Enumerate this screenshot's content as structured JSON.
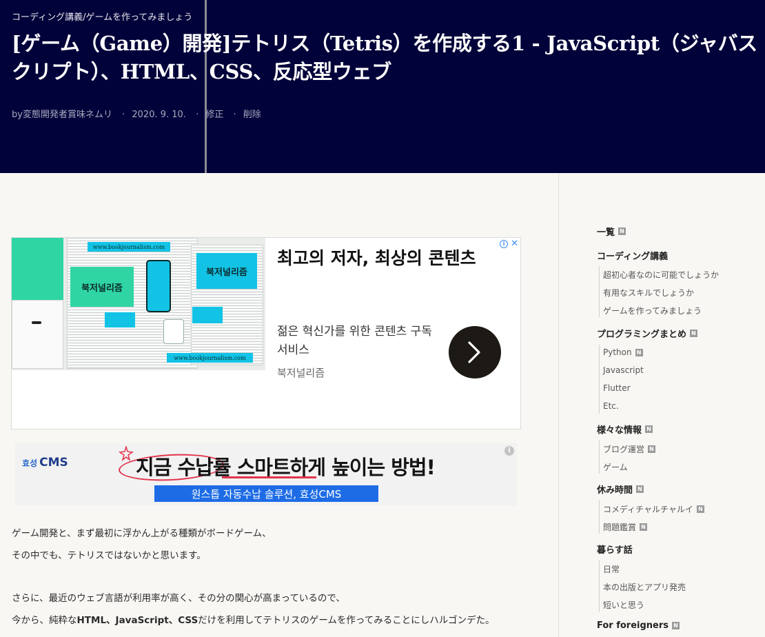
{
  "header": {
    "category": "コーディング講義/ゲームを作ってみましょう",
    "title": "[ゲーム（Game）開発]テトリス（Tetris）を作成する1 - JavaScript（ジャバスクリプト）、HTML、CSS、反応型ウェブ",
    "author": "by変態開発者賞味ネムリ",
    "date": "2020. 9. 10.",
    "edit_label": "修正",
    "delete_label": "削除"
  },
  "ad1": {
    "headline": "최고의 저자, 최상의 콘텐츠",
    "description": "젊은 혁신가를 위한 콘텐츠 구독 서비스",
    "brand": "북저널리즘",
    "image_label": "북저널리즘",
    "image_url": "www.bookjournalism.com"
  },
  "ad2": {
    "logo_prefix": "효성",
    "logo_name": "CMS",
    "headline": "지금 수납률 스마트하게 높이는 방법!",
    "bar_text": "원스톱 자동수납 솔루션, 효성CMS",
    "info_glyph": "i"
  },
  "body": {
    "lines": [
      "ゲーム開発と、まず最初に浮かん上がる種類がボードゲーム、",
      "その中でも、テトリスではないかと思います。",
      "さらに、最近のウェブ言語が利用率が高く、その分の関心が高まっているので、"
    ],
    "line4_prefix": "今から、純粋な",
    "line4_bold": "HTML、JavaScript、CSS",
    "line4_suffix": "だけを利用してテトリスのゲームを作ってみることにしハルゴンデた。"
  },
  "sidebar": {
    "badge": "N",
    "all_label": "一覧",
    "groups": [
      {
        "title": "コーディング講義",
        "items": [
          "超初心者なのに可能でしょうか",
          "有用なスキルでしょうか",
          "ゲームを作ってみましょう"
        ]
      },
      {
        "title": "プログラミングまとめ",
        "items": [
          "Python",
          "Javascript",
          "Flutter",
          "Etc."
        ]
      },
      {
        "title": "様々な情報",
        "items": [
          "ブログ運営",
          "ゲーム"
        ]
      },
      {
        "title": "休み時間",
        "items": [
          "コメディチャルチャルイ",
          "問題鑑賞"
        ]
      },
      {
        "title": "暮らす話",
        "items": [
          "日常",
          "本の出版とアプリ発売",
          "短いと思う"
        ]
      },
      {
        "title": "For foreigners",
        "items": []
      }
    ]
  },
  "colors": {
    "header_bg": "#02023a",
    "ad_accent_green": "#2fd6a4",
    "ad_accent_blue": "#12c3e6",
    "ad2_bar": "#1d6ce6",
    "ad2_highlight": "#e2344c"
  }
}
